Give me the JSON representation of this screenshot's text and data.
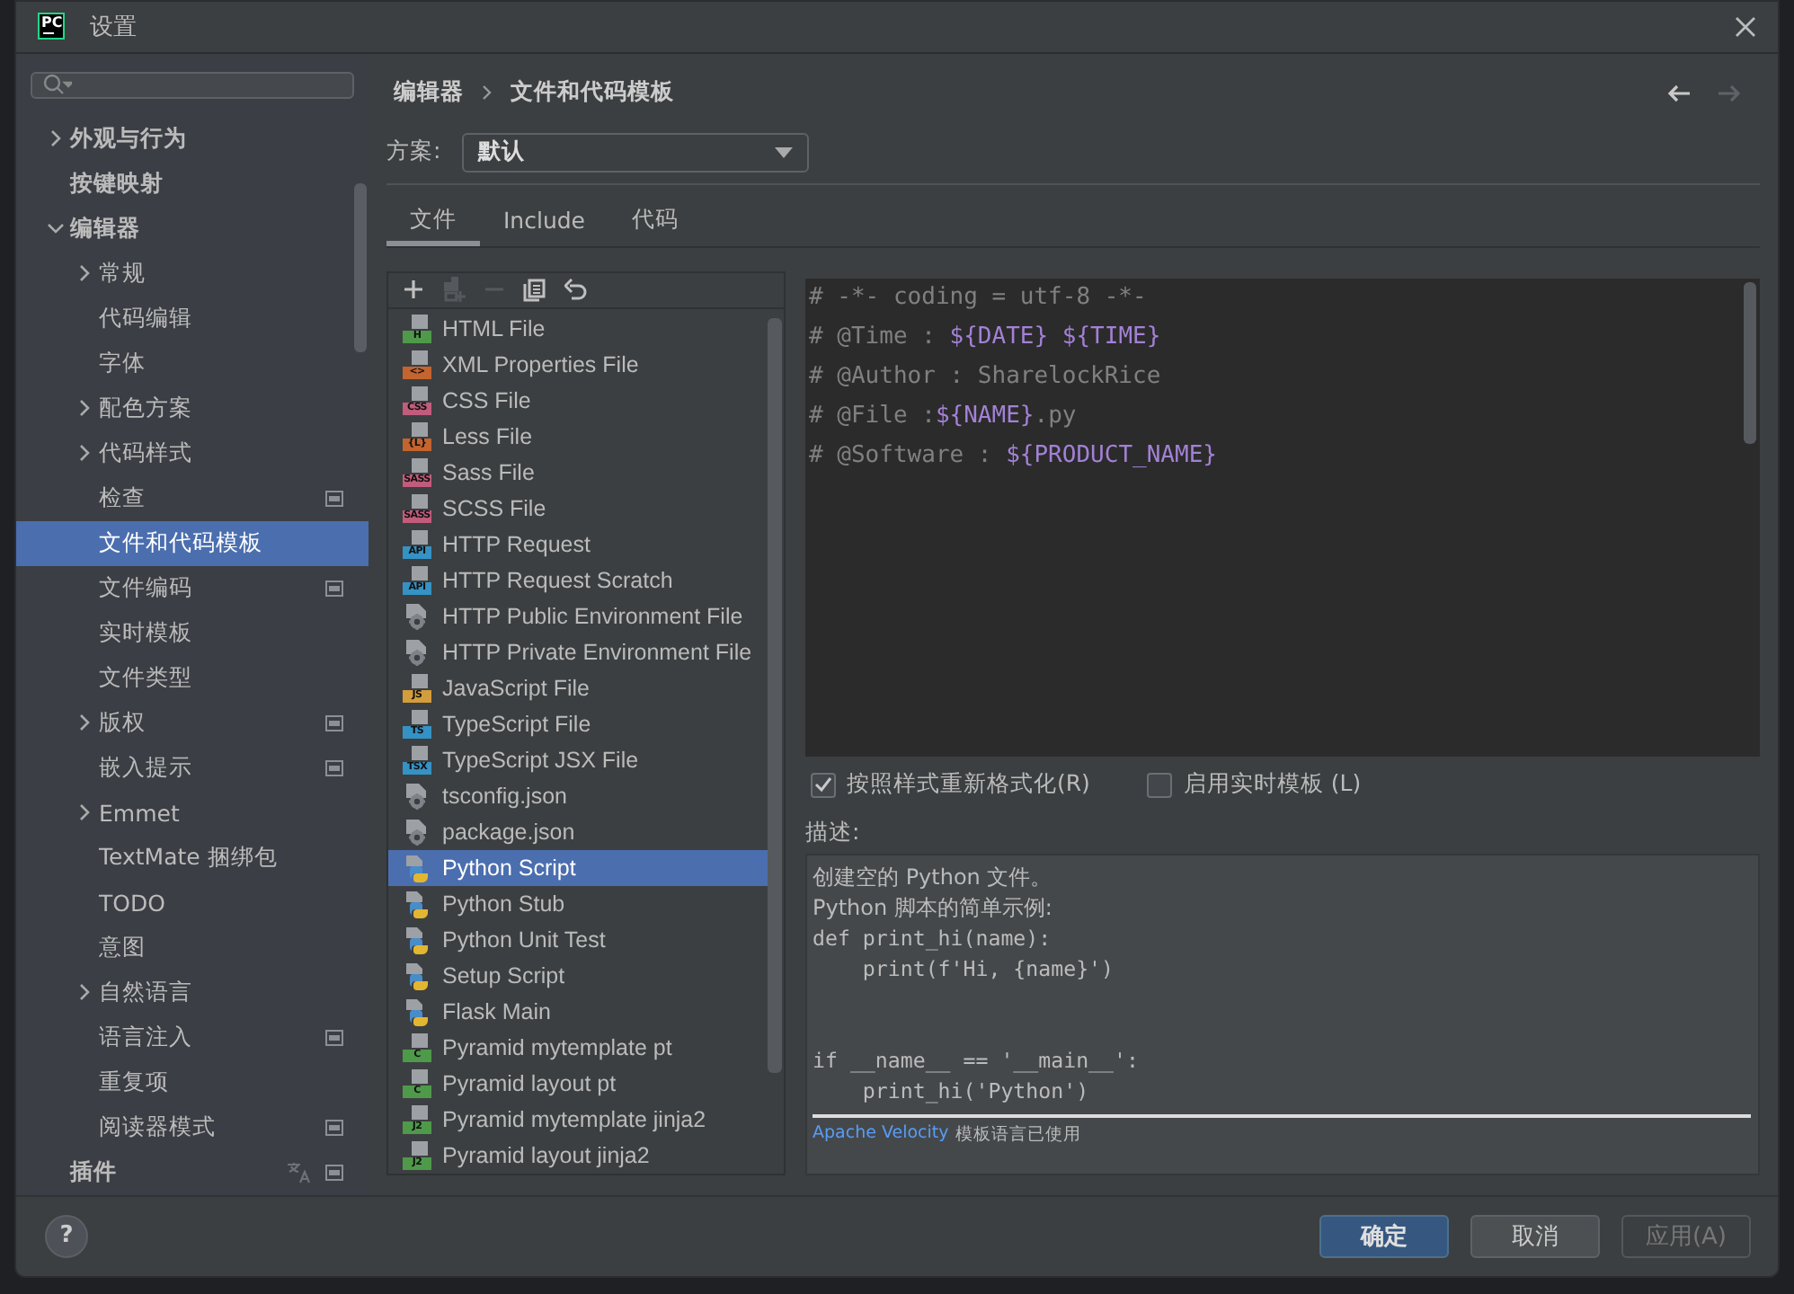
{
  "window": {
    "logo": "PC",
    "title": "设置"
  },
  "sidebar": {
    "items": [
      {
        "label": "外观与行为",
        "expanded": false,
        "selected": false
      },
      {
        "label": "按键映射",
        "selected": false
      },
      {
        "label": "编辑器",
        "expanded": true,
        "selected": false,
        "children": [
          {
            "label": "常规",
            "expanded": false,
            "selected": false
          },
          {
            "label": "代码编辑",
            "selected": false
          },
          {
            "label": "字体",
            "selected": false
          },
          {
            "label": "配色方案",
            "expanded": false,
            "selected": false
          },
          {
            "label": "代码样式",
            "expanded": false,
            "selected": false
          },
          {
            "label": "检查",
            "selected": false,
            "project_icon": true
          },
          {
            "label": "文件和代码模板",
            "selected": true
          },
          {
            "label": "文件编码",
            "selected": false,
            "project_icon": true
          },
          {
            "label": "实时模板",
            "selected": false
          },
          {
            "label": "文件类型",
            "selected": false
          },
          {
            "label": "版权",
            "expanded": false,
            "selected": false,
            "project_icon": true
          },
          {
            "label": "嵌入提示",
            "selected": false,
            "project_icon": true
          },
          {
            "label": "Emmet",
            "expanded": false,
            "selected": false
          },
          {
            "label": "TextMate 捆绑包",
            "selected": false
          },
          {
            "label": "TODO",
            "selected": false
          },
          {
            "label": "意图",
            "selected": false
          },
          {
            "label": "自然语言",
            "expanded": false,
            "selected": false
          },
          {
            "label": "语言注入",
            "selected": false,
            "project_icon": true
          },
          {
            "label": "重复项",
            "selected": false
          },
          {
            "label": "阅读器模式",
            "selected": false,
            "project_icon": true
          }
        ]
      },
      {
        "label": "插件",
        "selected": false,
        "translate_icon": true,
        "project_icon": true
      }
    ]
  },
  "breadcrumb": [
    "编辑器",
    "文件和代码模板"
  ],
  "nav": {
    "back": {
      "disabled": false
    },
    "forward": {
      "disabled": true
    }
  },
  "scheme": {
    "label": "方案:",
    "value": "默认"
  },
  "tabs": [
    {
      "label": "文件",
      "selected": true
    },
    {
      "label": "Include",
      "selected": false
    },
    {
      "label": "代码",
      "selected": false
    }
  ],
  "toolbar": [
    {
      "kind": "add",
      "disabled": false
    },
    {
      "kind": "copy-add",
      "disabled": true
    },
    {
      "kind": "remove",
      "disabled": true
    },
    {
      "kind": "copy",
      "disabled": false
    },
    {
      "kind": "revert",
      "disabled": false
    }
  ],
  "templates": [
    {
      "name": "HTML File",
      "kind": "badge",
      "badge": "H",
      "color": "#4f9a4a",
      "selected": false
    },
    {
      "name": "XML Properties File",
      "kind": "badge",
      "badge": "<>",
      "color": "#c4642e",
      "selected": false
    },
    {
      "name": "CSS File",
      "kind": "badge",
      "badge": "CSS",
      "color": "#c25c7c",
      "selected": false
    },
    {
      "name": "Less File",
      "kind": "badge",
      "badge": "{L}",
      "color": "#c4642e",
      "selected": false
    },
    {
      "name": "Sass File",
      "kind": "badge",
      "badge": "SASS",
      "color": "#c25c7c",
      "selected": false
    },
    {
      "name": "SCSS File",
      "kind": "badge",
      "badge": "SASS",
      "color": "#c25c7c",
      "selected": false
    },
    {
      "name": "HTTP Request",
      "kind": "badge",
      "badge": "API",
      "color": "#3592c4",
      "selected": false
    },
    {
      "name": "HTTP Request Scratch",
      "kind": "badge",
      "badge": "API",
      "color": "#3592c4",
      "selected": false
    },
    {
      "name": "HTTP Public Environment File",
      "kind": "gear",
      "selected": false
    },
    {
      "name": "HTTP Private Environment File",
      "kind": "gear",
      "selected": false
    },
    {
      "name": "JavaScript File",
      "kind": "badge",
      "badge": "JS",
      "color": "#d29d3c",
      "selected": false
    },
    {
      "name": "TypeScript File",
      "kind": "badge",
      "badge": "TS",
      "color": "#3592c4",
      "selected": false
    },
    {
      "name": "TypeScript JSX File",
      "kind": "badge",
      "badge": "TSX",
      "color": "#3592c4",
      "selected": false
    },
    {
      "name": "tsconfig.json",
      "kind": "gear",
      "selected": false
    },
    {
      "name": "package.json",
      "kind": "gear",
      "selected": false
    },
    {
      "name": "Python Script",
      "kind": "python",
      "selected": true
    },
    {
      "name": "Python Stub",
      "kind": "python",
      "selected": false
    },
    {
      "name": "Python Unit Test",
      "kind": "python",
      "selected": false
    },
    {
      "name": "Setup Script",
      "kind": "python",
      "selected": false
    },
    {
      "name": "Flask Main",
      "kind": "python",
      "selected": false
    },
    {
      "name": "Pyramid mytemplate pt",
      "kind": "badge",
      "badge": "C",
      "color": "#4f9a4a",
      "selected": false
    },
    {
      "name": "Pyramid layout pt",
      "kind": "badge",
      "badge": "C",
      "color": "#4f9a4a",
      "selected": false
    },
    {
      "name": "Pyramid mytemplate jinja2",
      "kind": "badge",
      "badge": "J2",
      "color": "#4f9a4a",
      "selected": false
    },
    {
      "name": "Pyramid layout jinja2",
      "kind": "badge",
      "badge": "J2",
      "color": "#4f9a4a",
      "selected": false
    }
  ],
  "editor": {
    "lines": [
      [
        {
          "text": "# -*- coding = utf-8 -*-",
          "kind": "comment"
        }
      ],
      [
        {
          "text": "# @Time : ",
          "kind": "comment"
        },
        {
          "text": "${DATE}",
          "kind": "variable"
        },
        {
          "text": "${TIME}",
          "kind": "variable",
          "space_before": true
        }
      ],
      [
        {
          "text": "# @Author : SharelockRice",
          "kind": "comment"
        }
      ],
      [
        {
          "text": "# @File :",
          "kind": "comment"
        },
        {
          "text": "${NAME}",
          "kind": "variable"
        },
        {
          "text": ".py",
          "kind": "comment"
        }
      ],
      [
        {
          "text": "# @Software : ",
          "kind": "comment"
        },
        {
          "text": "${PRODUCT_NAME}",
          "kind": "variable"
        }
      ]
    ]
  },
  "options": [
    {
      "label": "按照样式重新格式化(R)",
      "checked": true
    },
    {
      "label": "启用实时模板 (L)",
      "checked": false
    }
  ],
  "description": {
    "label": "描述:",
    "lines": [
      {
        "text": "创建空的 Python 文件。",
        "kind": "prose"
      },
      {
        "text": "Python 脚本的简单示例:",
        "kind": "prose"
      },
      {
        "text": "def print_hi(name):",
        "kind": "code"
      },
      {
        "text": "    print(f'Hi, {name}')",
        "kind": "code"
      },
      {
        "kind": "blank"
      },
      {
        "kind": "blank"
      },
      {
        "text": "if __name__ == '__main__':",
        "kind": "code"
      },
      {
        "text": "    print_hi('Python')",
        "kind": "code"
      }
    ],
    "footer_link": "Apache Velocity",
    "footer_text": "模板语言已使用"
  },
  "footer": {
    "help": "?",
    "buttons": [
      {
        "label": "确定",
        "kind": "primary"
      },
      {
        "label": "取消",
        "kind": "normal"
      },
      {
        "label": "应用(A)",
        "kind": "disabled"
      }
    ]
  }
}
